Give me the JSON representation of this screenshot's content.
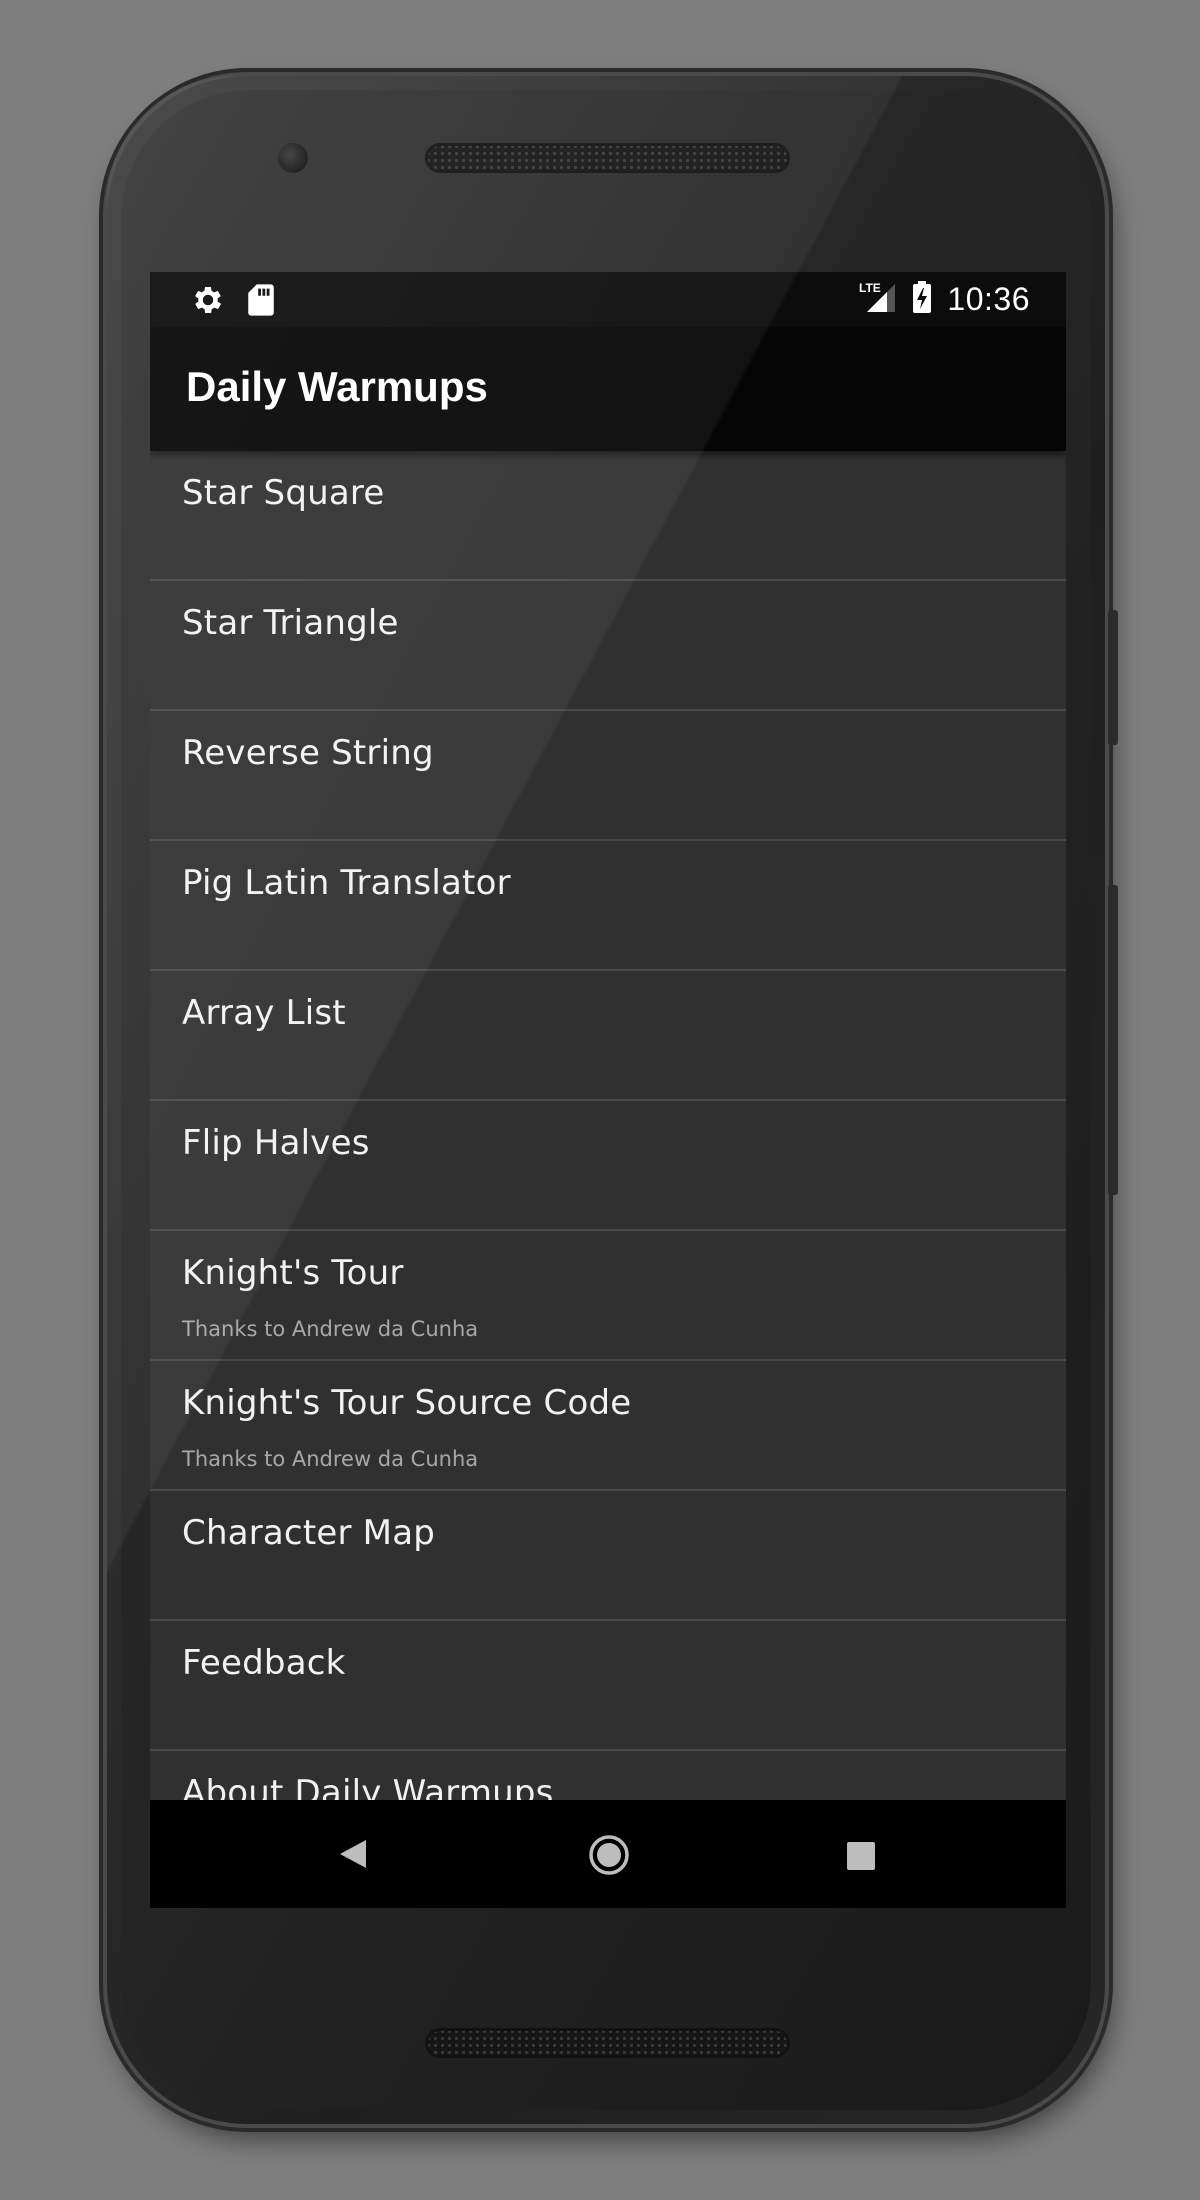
{
  "status_bar": {
    "time": "10:36",
    "network": "LTE",
    "left_icons": [
      "settings-icon",
      "sd-card-icon"
    ],
    "right_icons": [
      "lte-signal-icon",
      "battery-charging-icon"
    ]
  },
  "app_bar": {
    "title": "Daily Warmups"
  },
  "list": {
    "items": [
      {
        "title": "Star Square",
        "subtitle": ""
      },
      {
        "title": "Star Triangle",
        "subtitle": ""
      },
      {
        "title": "Reverse String",
        "subtitle": ""
      },
      {
        "title": "Pig Latin Translator",
        "subtitle": ""
      },
      {
        "title": "Array List",
        "subtitle": ""
      },
      {
        "title": "Flip Halves",
        "subtitle": ""
      },
      {
        "title": "Knight's Tour",
        "subtitle": "Thanks to Andrew da Cunha"
      },
      {
        "title": "Knight's Tour Source Code",
        "subtitle": "Thanks to Andrew da Cunha"
      },
      {
        "title": "Character Map",
        "subtitle": ""
      },
      {
        "title": "Feedback",
        "subtitle": ""
      },
      {
        "title": "About Daily Warmups",
        "subtitle": ""
      }
    ]
  },
  "nav_bar": {
    "icons": [
      "back-icon",
      "home-icon",
      "recents-icon"
    ]
  },
  "colors": {
    "background": "#7f7f7f",
    "list_bg": "#303030",
    "app_bar_bg": "#050505",
    "divider": "#4a4a4a",
    "text": "#f2f2f2",
    "subtext": "#a8a8a8"
  }
}
